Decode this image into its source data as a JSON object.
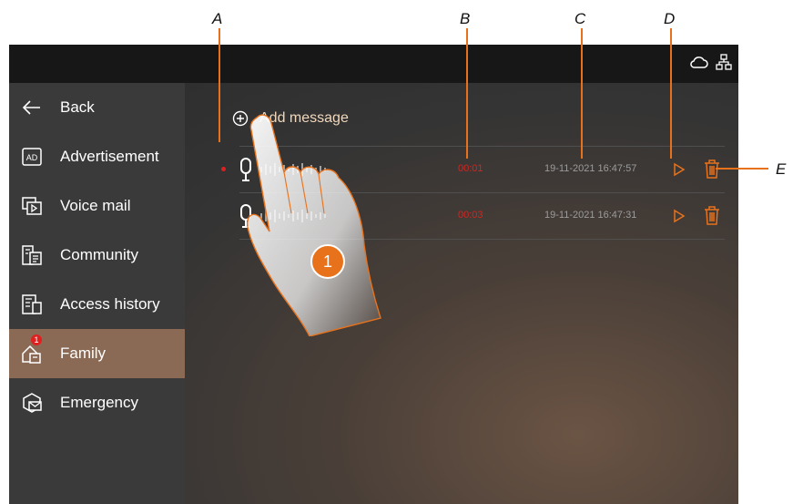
{
  "callouts": [
    "A",
    "B",
    "C",
    "D",
    "E"
  ],
  "status_icons": [
    "cloud-icon",
    "network-icon"
  ],
  "sidebar": {
    "items": [
      {
        "label": "Back",
        "icon": "arrow-left-icon"
      },
      {
        "label": "Advertisement",
        "icon": "ad-icon"
      },
      {
        "label": "Voice mail",
        "icon": "voicemail-icon"
      },
      {
        "label": "Community",
        "icon": "community-icon"
      },
      {
        "label": "Access history",
        "icon": "access-history-icon"
      },
      {
        "label": "Family",
        "icon": "family-icon",
        "active": true,
        "badge": "1"
      },
      {
        "label": "Emergency",
        "icon": "emergency-icon"
      }
    ]
  },
  "main": {
    "add_message_label": "Add message",
    "messages": [
      {
        "unread": true,
        "duration": "00:01",
        "timestamp": "19-11-2021 16:47:57"
      },
      {
        "unread": false,
        "duration": "00:03",
        "timestamp": "19-11-2021 16:47:31"
      }
    ]
  },
  "step_marker": "1",
  "colors": {
    "accent": "#e8721c",
    "active_item": "#8b6a55",
    "duration": "#d8231f",
    "sidebar": "#3a3a3a",
    "topbar": "#171717"
  }
}
